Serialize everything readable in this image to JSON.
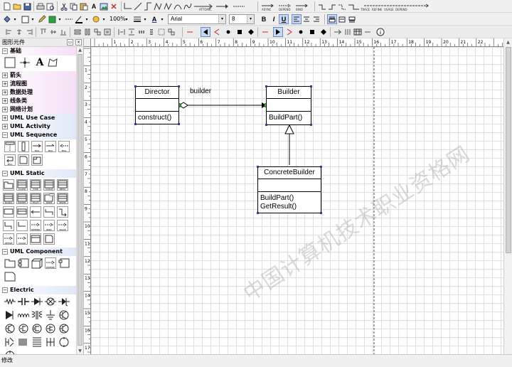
{
  "toolbar": {
    "zoom": "100%",
    "font_name": "Arial",
    "font_size": "8",
    "bold_label": "B",
    "italic_label": "I",
    "underline_label": "U",
    "text_color_label": "A",
    "text_tool_label": "A",
    "line_label_wrap": "ATTOMIC",
    "line_label_dep": "DEPEND",
    "mini_labels": [
      "ASYNC",
      "DEPEND",
      "BIND",
      "TRACE",
      "REFINE",
      "USAGE",
      "DEPEND"
    ]
  },
  "palette": {
    "title": "图形元件",
    "categories": [
      {
        "label": "基础",
        "expanded": true,
        "style": "pink"
      },
      {
        "label": "箭头",
        "expanded": false,
        "style": "pink"
      },
      {
        "label": "流程图",
        "expanded": false,
        "style": "pink"
      },
      {
        "label": "数据处理",
        "expanded": false,
        "style": "pink"
      },
      {
        "label": "线条类",
        "expanded": false,
        "style": "pink"
      },
      {
        "label": "网络计划",
        "expanded": false,
        "style": "pink"
      },
      {
        "label": "UML Use Case",
        "expanded": false,
        "style": "blue"
      },
      {
        "label": "UML Activity",
        "expanded": false,
        "style": "blue"
      },
      {
        "label": "UML Sequence",
        "expanded": true,
        "style": "blue"
      },
      {
        "label": "UML Static",
        "expanded": true,
        "style": "blue"
      },
      {
        "label": "UML Component",
        "expanded": true,
        "style": "blue"
      },
      {
        "label": "Electric",
        "expanded": true,
        "style": "blue"
      }
    ],
    "icon_labels": {
      "seq_msg": "MSG",
      "static_row1": [
        "",
        "CLASS",
        "TYPE",
        "U-FACE",
        "META"
      ],
      "static_row2": [
        "SIGNAL",
        "EXCEPT",
        "UTILITY",
        "PARM",
        "ENUM"
      ],
      "static_row3": [
        "",
        "DEPEND",
        "BIND",
        "TRACE"
      ],
      "static_row4": [
        "REFINE",
        "USAGE"
      ],
      "comp_depend": "DEPEND"
    }
  },
  "diagram": {
    "classes": [
      {
        "name": "Director",
        "operations": [
          "construct()"
        ]
      },
      {
        "name": "Builder",
        "operations": [
          "BuildPart()"
        ]
      },
      {
        "name": "ConcreteBuilder",
        "operations": [
          "BuildPart()",
          "GetResult()"
        ]
      }
    ],
    "association_label": "builder",
    "ruler_numbers": [
      "1",
      "2",
      "3",
      "4",
      "5",
      "6",
      "7",
      "8",
      "9",
      "10",
      "11",
      "12",
      "13",
      "14",
      "15",
      "16",
      "17",
      "18",
      "19",
      "20",
      "21",
      "22"
    ]
  },
  "watermark": "中国计算机技术职业资格网",
  "status": {
    "text": "修改"
  }
}
